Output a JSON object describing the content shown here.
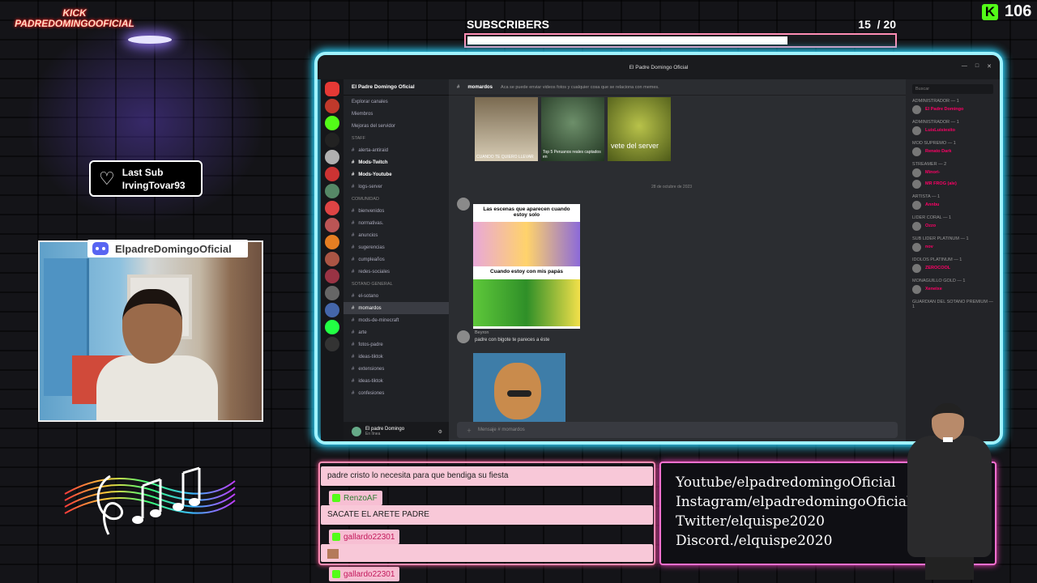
{
  "overlay": {
    "kick_tag_line1": "KICK",
    "kick_tag_line2": "PADREDOMINGOOFICIAL",
    "subscribers_label": "SUBSCRIBERS",
    "subscribers_current": 15,
    "subscribers_goal": 20,
    "subscribers_count_text": "15  / 20",
    "subscribers_progress": 0.75,
    "viewer_count": "106",
    "last_sub_title": "Last Sub",
    "last_sub_name": "IrvingTovar93",
    "discord_banner": "ElpadreDomingoOficial",
    "accent_colors": {
      "kick": "#53fc18",
      "frame": "#2ad6ff",
      "chat": "#ff8db4",
      "social": "#ff70d0"
    }
  },
  "discord": {
    "window_title": "El Padre Domingo Oficial",
    "server_name": "El Padre Domingo Oficial",
    "server_menu": [
      {
        "label": "Explorar canales"
      },
      {
        "label": "Miembros"
      },
      {
        "label": "Mejoras del servidor"
      }
    ],
    "channels": [
      {
        "label": "STAFF",
        "type": "category"
      },
      {
        "label": "alerta-antiraid"
      },
      {
        "label": "Mods-Twitch",
        "bold": true
      },
      {
        "label": "Mods-Youtube",
        "bold": true
      },
      {
        "label": "logs-server"
      },
      {
        "label": "COMUNIDAD",
        "type": "category"
      },
      {
        "label": "bienvenidos"
      },
      {
        "label": "normativas."
      },
      {
        "label": "anuncios"
      },
      {
        "label": "sugerencias"
      },
      {
        "label": "cumpleaños"
      },
      {
        "label": "redes-sociales"
      },
      {
        "label": "SOTANO GENERAL",
        "type": "category"
      },
      {
        "label": "el-sotano"
      },
      {
        "label": "momardos",
        "selected": true
      },
      {
        "label": "mods-de-minecraft"
      },
      {
        "label": "arte"
      },
      {
        "label": "fotos-padre"
      },
      {
        "label": "ideas-tiktok"
      },
      {
        "label": "extensiones"
      },
      {
        "label": "ideas-tiktok"
      },
      {
        "label": "confesiones"
      }
    ],
    "user_name": "El padre Domingo",
    "user_status": "En línea",
    "channel_header": "momardos",
    "channel_topic": "Aca se puede enviar videos fotos y cualquier cosa que se relaciona con memes.",
    "thumb_captions": [
      "CUANDO TE QUIERO LLEVAR",
      "Top 5 Peruanos reales captados en",
      "vete del server"
    ],
    "date_separator": "28 de octubre de 2023",
    "meme_top": "Las escenas que aparecen cuando estoy solo",
    "meme_bottom": "Cuando estoy con mis papás",
    "message2_author": "Beyron",
    "message2_text": "padre con bigote te pareces a éste",
    "composer_placeholder": "Mensaje # momardos",
    "search_placeholder": "Buscar",
    "members": [
      {
        "role": "ADMINISTRADOR — 1",
        "name": "El Padre Domingo"
      },
      {
        "role": "ADMINISTRADOR — 1",
        "name": "LuisLuisiesito"
      },
      {
        "role": "MOD SUPREMO — 1",
        "name": "Renato Dark"
      },
      {
        "role": "STREAMER — 2",
        "name": "Minori-"
      },
      {
        "role": "",
        "name": "MR FROG (ale)"
      },
      {
        "role": "ARTISTA — 1",
        "name": "Annbu"
      },
      {
        "role": "LIDER CORAL — 1",
        "name": "Ozzo"
      },
      {
        "role": "SUB LIDER PLATINUM — 1",
        "name": "nov"
      },
      {
        "role": "IDOLOS PLATINUM — 1",
        "name": "ZEROCOOL"
      },
      {
        "role": "MONAGUILLO GOLD — 1",
        "name": "Xeneixe"
      },
      {
        "role": "Guardian del Sotano PREMIUM — 1",
        "name": ""
      }
    ]
  },
  "chat": {
    "messages": [
      {
        "user": "",
        "text": "padre cristo lo necesita para que bendiga su fiesta"
      },
      {
        "user": "RenzoAF",
        "text": "SACATE EL ARETE PADRE"
      },
      {
        "user": "gallardo22301",
        "text": ""
      },
      {
        "user": "gallardo22301",
        "text": ""
      }
    ]
  },
  "socials": [
    "Youtube/elpadredomingoOficial",
    "Instagram/elpadredomingoOficial",
    "Twitter/elquispe2020",
    "Discord./elquispe2020"
  ]
}
